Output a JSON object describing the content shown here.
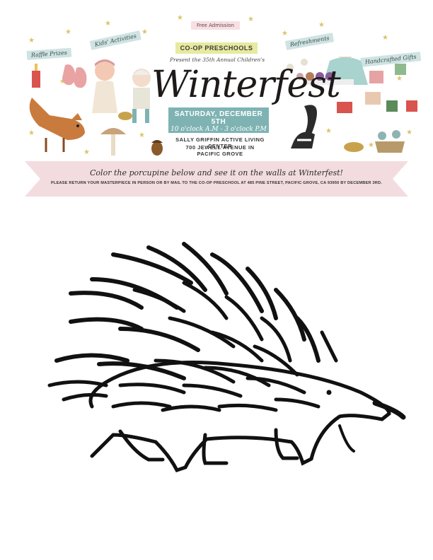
{
  "header": {
    "admission": "Free Admission",
    "org": "CO-OP PRESCHOOLS",
    "presents": "Present the 35th Annual Children's",
    "title": "Winterfest",
    "date": "SATURDAY, DECEMBER 5TH",
    "time": "10 o'clock A.M - 3 o'clock P.M",
    "venue_name": "SALLY GRIFFIN ACTIVE LIVING CENTER",
    "venue_address": "700 JEWELL AVENUE IN PACIFIC GROVE",
    "tags": {
      "raffle": "Raffle Prizes",
      "kids": "Kids' Activities",
      "refreshments": "Refreshments",
      "gifts": "Handcrafted Gifts"
    }
  },
  "ribbon": {
    "headline": "Color the porcupine below and see it on the walls at Winterfest!",
    "instructions": "PLEASE RETURN YOUR MASTERPIECE IN PERSON OR BY MAIL TO THE CO-OP PRESCHOOL AT 485 PINE STREET, PACIFIC GROVE, CA 93950 BY DECEMBER 3RD."
  },
  "colors": {
    "star": "#dcc36b",
    "teal": "#7fb3b3",
    "pink": "#f3dcdf",
    "lime": "#e7ea9f"
  }
}
